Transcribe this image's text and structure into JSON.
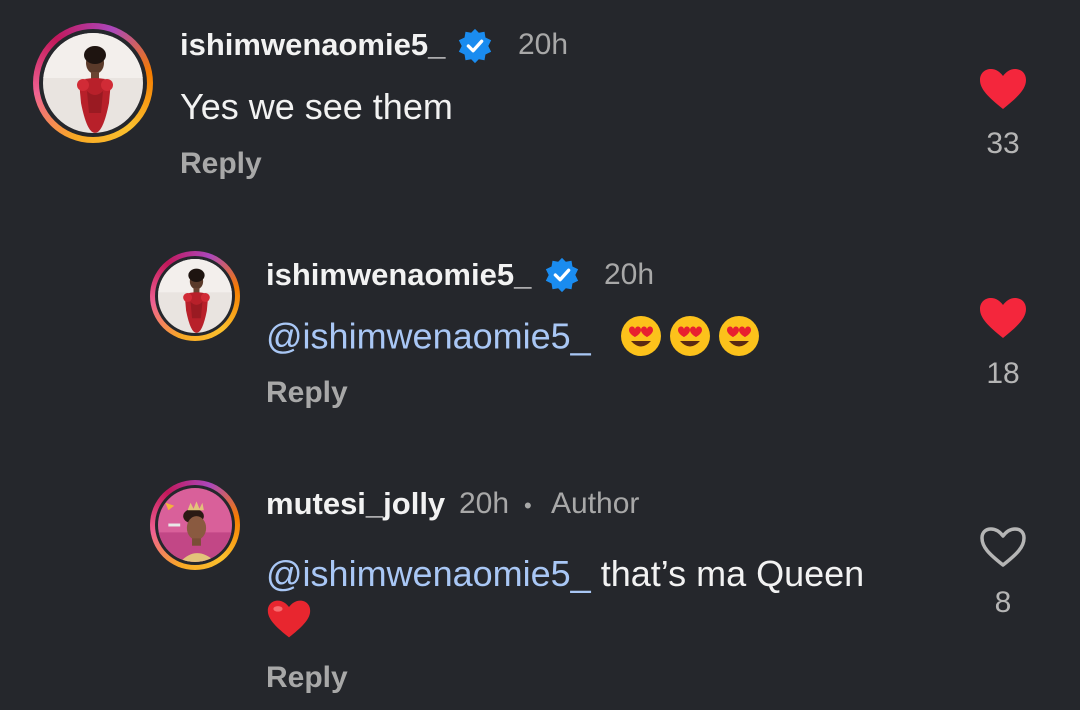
{
  "comments": [
    {
      "username": "ishimwenaomie5_",
      "verified": true,
      "time": "20h",
      "text": "Yes we see them",
      "reply_label": "Reply",
      "likes": "33",
      "liked": true,
      "avatar_icon": "woman-red-dress-photo"
    },
    {
      "username": "ishimwenaomie5_",
      "verified": true,
      "time": "20h",
      "mention": "@ishimwenaomie5_",
      "emojis": [
        "heart-eyes-emoji",
        "heart-eyes-emoji",
        "heart-eyes-emoji"
      ],
      "reply_label": "Reply",
      "likes": "18",
      "liked": true,
      "avatar_icon": "woman-red-dress-photo"
    },
    {
      "username": "mutesi_jolly",
      "verified": false,
      "time": "20h",
      "separator": "•",
      "author_label": "Author",
      "mention": "@ishimwenaomie5_",
      "text": "that’s ma Queen",
      "trailing_emoji": "red-heart-emoji",
      "reply_label": "Reply",
      "likes": "8",
      "liked": false,
      "avatar_icon": "woman-crown-pink-photo"
    }
  ],
  "colors": {
    "background": "#25272c",
    "like_red": "#f4263c",
    "mention_blue": "#a9c7f5",
    "verified_blue": "#1a8cf0",
    "muted_text": "#a8a8a8"
  }
}
